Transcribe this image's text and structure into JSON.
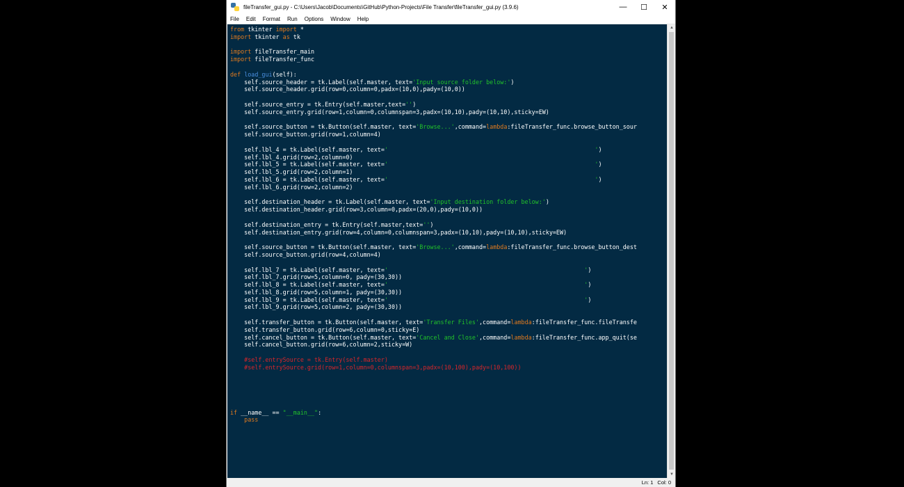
{
  "window": {
    "title": "fileTransfer_gui.py - C:\\Users\\Jacob\\Documents\\GitHub\\Python-Projects\\File Transfer\\fileTransfer_gui.py (3.9.6)",
    "controls": {
      "minimize": "—",
      "maximize": "☐",
      "close": "✕"
    }
  },
  "menu": [
    "File",
    "Edit",
    "Format",
    "Run",
    "Options",
    "Window",
    "Help"
  ],
  "status": {
    "line": "Ln: 1",
    "col": "Col: 0"
  },
  "colors": {
    "editor_bg": "#032a43",
    "keyword": "#e07a1f",
    "builtin": "#4a8fe0",
    "string": "#22c22a",
    "comment": "#d9262a",
    "text": "#ffffff"
  },
  "code_lines": [
    [
      [
        "kw",
        "from"
      ],
      [
        "t",
        " tkinter "
      ],
      [
        "kw",
        "import"
      ],
      [
        "t",
        " *"
      ]
    ],
    [
      [
        "kw",
        "import"
      ],
      [
        "t",
        " tkinter "
      ],
      [
        "kw",
        "as"
      ],
      [
        "t",
        " tk"
      ]
    ],
    [],
    [
      [
        "kw",
        "import"
      ],
      [
        "t",
        " fileTransfer_main"
      ]
    ],
    [
      [
        "kw",
        "import"
      ],
      [
        "t",
        " fileTransfer_func"
      ]
    ],
    [],
    [
      [
        "kw",
        "def"
      ],
      [
        "t",
        " "
      ],
      [
        "fn",
        "load_gui"
      ],
      [
        "t",
        "(self):"
      ]
    ],
    [
      [
        "t",
        "    self.source_header = tk.Label(self.master, text="
      ],
      [
        "str",
        "'Input source folder below:'"
      ],
      [
        "t",
        ")"
      ]
    ],
    [
      [
        "t",
        "    self.source_header.grid(row=0,column=0,padx=(10,0),pady=(10,0))"
      ]
    ],
    [],
    [
      [
        "t",
        "    self.source_entry = tk.Entry(self.master,text="
      ],
      [
        "str",
        "''"
      ],
      [
        "t",
        ")"
      ]
    ],
    [
      [
        "t",
        "    self.source_entry.grid(row=1,column=0,columnspan=3,padx=(10,10),pady=(10,10),sticky=EW)"
      ]
    ],
    [],
    [
      [
        "t",
        "    self.source_button = tk.Button(self.master, text="
      ],
      [
        "str",
        "'Browse...'"
      ],
      [
        "t",
        ",command="
      ],
      [
        "kw",
        "lambda"
      ],
      [
        "t",
        ":fileTransfer_func.browse_button_sour"
      ]
    ],
    [
      [
        "t",
        "    self.source_button.grid(row=1,column=4)"
      ]
    ],
    [],
    [
      [
        "t",
        "    self.lbl_4 = tk.Label(self.master, text="
      ],
      [
        "str",
        "'                                                           '"
      ],
      [
        "t",
        ")"
      ]
    ],
    [
      [
        "t",
        "    self.lbl_4.grid(row=2,column=0)"
      ]
    ],
    [
      [
        "t",
        "    self.lbl_5 = tk.Label(self.master, text="
      ],
      [
        "str",
        "'                                                           '"
      ],
      [
        "t",
        ")"
      ]
    ],
    [
      [
        "t",
        "    self.lbl_5.grid(row=2,column=1)"
      ]
    ],
    [
      [
        "t",
        "    self.lbl_6 = tk.Label(self.master, text="
      ],
      [
        "str",
        "'                                                           '"
      ],
      [
        "t",
        ")"
      ]
    ],
    [
      [
        "t",
        "    self.lbl_6.grid(row=2,column=2)"
      ]
    ],
    [],
    [
      [
        "t",
        "    self.destination_header = tk.Label(self.master, text="
      ],
      [
        "str",
        "'Input destination folder below:'"
      ],
      [
        "t",
        ")"
      ]
    ],
    [
      [
        "t",
        "    self.destination_header.grid(row=3,column=0,padx=(20,0),pady=(10,0))"
      ]
    ],
    [],
    [
      [
        "t",
        "    self.destination_entry = tk.Entry(self.master,text="
      ],
      [
        "str",
        "''"
      ],
      [
        "t",
        ")"
      ]
    ],
    [
      [
        "t",
        "    self.destination_entry.grid(row=4,column=0,columnspan=3,padx=(10,10),pady=(10,10),sticky=EW)"
      ]
    ],
    [],
    [
      [
        "t",
        "    self.source_button = tk.Button(self.master, text="
      ],
      [
        "str",
        "'Browse...'"
      ],
      [
        "t",
        ",command="
      ],
      [
        "kw",
        "lambda"
      ],
      [
        "t",
        ":fileTransfer_func.browse_button_dest"
      ]
    ],
    [
      [
        "t",
        "    self.source_button.grid(row=4,column=4)"
      ]
    ],
    [],
    [
      [
        "t",
        "    self.lbl_7 = tk.Label(self.master, text="
      ],
      [
        "str",
        "'                                                        '"
      ],
      [
        "t",
        ")"
      ]
    ],
    [
      [
        "t",
        "    self.lbl_7.grid(row=5,column=0, pady=(30,30))"
      ]
    ],
    [
      [
        "t",
        "    self.lbl_8 = tk.Label(self.master, text="
      ],
      [
        "str",
        "'                                                        '"
      ],
      [
        "t",
        ")"
      ]
    ],
    [
      [
        "t",
        "    self.lbl_8.grid(row=5,column=1, pady=(30,30))"
      ]
    ],
    [
      [
        "t",
        "    self.lbl_9 = tk.Label(self.master, text="
      ],
      [
        "str",
        "'                                                        '"
      ],
      [
        "t",
        ")"
      ]
    ],
    [
      [
        "t",
        "    self.lbl_9.grid(row=5,column=2, pady=(30,30))"
      ]
    ],
    [],
    [
      [
        "t",
        "    self.transfer_button = tk.Button(self.master, text="
      ],
      [
        "str",
        "'Transfer Files'"
      ],
      [
        "t",
        ",command="
      ],
      [
        "kw",
        "lambda"
      ],
      [
        "t",
        ":fileTransfer_func.fileTransfe"
      ]
    ],
    [
      [
        "t",
        "    self.transfer_button.grid(row=6,column=0,sticky=E)"
      ]
    ],
    [
      [
        "t",
        "    self.cancel_button = tk.Button(self.master, text="
      ],
      [
        "str",
        "'Cancel and Close'"
      ],
      [
        "t",
        ",command="
      ],
      [
        "kw",
        "lambda"
      ],
      [
        "t",
        ":fileTransfer_func.app_quit(se"
      ]
    ],
    [
      [
        "t",
        "    self.cancel_button.grid(row=6,column=2,sticky=W)"
      ]
    ],
    [],
    [
      [
        "cm",
        "    #self.entrySource = tk.Entry(self.master)"
      ]
    ],
    [
      [
        "cm",
        "    #self.entrySource.grid(row=1,column=0,columnspan=3,padx=(10,100),pady=(10,100))"
      ]
    ],
    [],
    [],
    [],
    [],
    [],
    [
      [
        "kw",
        "if"
      ],
      [
        "t",
        " __name__ == "
      ],
      [
        "str",
        "\"__main__\""
      ],
      [
        "t",
        ":"
      ]
    ],
    [
      [
        "kw",
        "    pass"
      ]
    ]
  ]
}
